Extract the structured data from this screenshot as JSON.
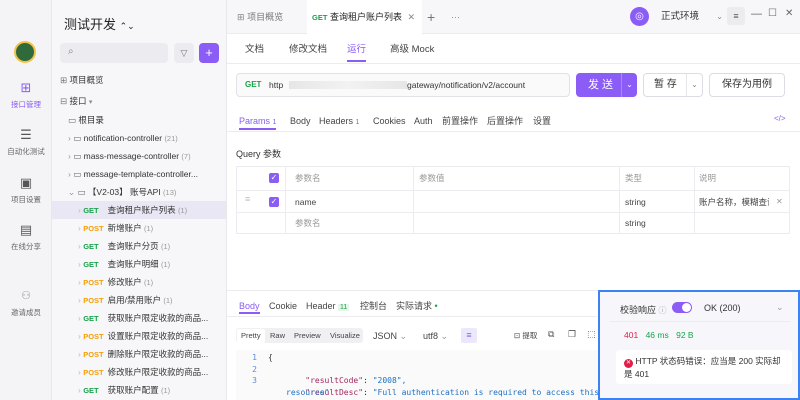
{
  "sidebar_rail": {
    "items": [
      {
        "label": "接口管理",
        "icon": "api-icon"
      },
      {
        "label": "自动化测试",
        "icon": "flask-icon"
      },
      {
        "label": "项目设置",
        "icon": "settings-icon"
      },
      {
        "label": "在线分享",
        "icon": "share-icon"
      },
      {
        "label": "邀请成员",
        "icon": "user-plus-icon"
      }
    ]
  },
  "project": {
    "title": "测试开发",
    "search_placeholder": "",
    "overview_label": "项目概览",
    "folder_label": "接口",
    "root_label": "根目录",
    "tree": [
      {
        "label": "notification-controller",
        "count": "(21)"
      },
      {
        "label": "mass-message-controller",
        "count": "(7)"
      },
      {
        "label": "message-template-controller...",
        "count": ""
      },
      {
        "label": "【V2-03】 账号API",
        "count": "(13)"
      }
    ],
    "endpoints": [
      {
        "method": "GET",
        "label": "查询租户账户列表",
        "count": "(1)"
      },
      {
        "method": "POST",
        "label": "新增账户",
        "count": "(1)"
      },
      {
        "method": "GET",
        "label": "查询账户分页",
        "count": "(1)"
      },
      {
        "method": "GET",
        "label": "查询账户明细",
        "count": "(1)"
      },
      {
        "method": "POST",
        "label": "修改账户",
        "count": "(1)"
      },
      {
        "method": "POST",
        "label": "启用/禁用账户",
        "count": "(1)"
      },
      {
        "method": "GET",
        "label": "获取账户限定收款的商品...",
        "count": ""
      },
      {
        "method": "POST",
        "label": "设置账户限定收款的商品...",
        "count": ""
      },
      {
        "method": "POST",
        "label": "删除账户限定收款的商品...",
        "count": ""
      },
      {
        "method": "POST",
        "label": "修改账户限定收款的商品...",
        "count": ""
      },
      {
        "method": "GET",
        "label": "获取账户配置",
        "count": "(1)"
      }
    ]
  },
  "top_tabs": {
    "overview": "项目概览",
    "active_method": "GET",
    "active_label": "查询租户账户列表",
    "add": "+",
    "more": "···",
    "env": "正式环境"
  },
  "sub_tabs": [
    "文档",
    "修改文档",
    "运行",
    "高级 Mock"
  ],
  "request": {
    "method": "GET",
    "url_prefix": "http",
    "url_suffix": "gateway/notification/v2/account",
    "send": "发 送",
    "save": "暂 存",
    "save_case": "保存为用例"
  },
  "param_tabs": [
    {
      "label": "Params",
      "badge": "1"
    },
    {
      "label": "Body",
      "badge": ""
    },
    {
      "label": "Headers",
      "badge": "1"
    },
    {
      "label": "Cookies",
      "badge": ""
    },
    {
      "label": "Auth",
      "badge": ""
    },
    {
      "label": "前置操作",
      "badge": ""
    },
    {
      "label": "后置操作",
      "badge": ""
    },
    {
      "label": "设置",
      "badge": ""
    }
  ],
  "query": {
    "title": "Query 参数",
    "headers": {
      "name": "参数名",
      "value": "参数值",
      "type": "类型",
      "desc": "说明"
    },
    "row": {
      "name": "name",
      "value": "",
      "type": "string",
      "desc": "账户名称，模糊查询"
    },
    "empty_row": {
      "name": "参数名",
      "type": "string"
    }
  },
  "response_tabs": [
    {
      "label": "Body",
      "badge": ""
    },
    {
      "label": "Cookie",
      "badge": ""
    },
    {
      "label": "Header",
      "badge": "11"
    },
    {
      "label": "控制台",
      "badge": ""
    },
    {
      "label": "实际请求",
      "badge": "•"
    }
  ],
  "response_tools": {
    "pretty": "Pretty",
    "raw": "Raw",
    "preview": "Preview",
    "visualize": "Visualize",
    "format": "JSON",
    "encoding": "utf8",
    "extract": "提取"
  },
  "code_lines": [
    {
      "n": "1",
      "text": "{"
    },
    {
      "n": "2",
      "key": "\"resultCode\"",
      "val": "\"2008\","
    },
    {
      "n": "3",
      "key": "\"resultDesc\"",
      "val": "\"Full authentication is required to access this"
    },
    {
      "n": "",
      "key": "",
      "val": "resource\""
    }
  ],
  "validation": {
    "label": "校验响应",
    "status": "OK (200)",
    "code": "401",
    "time": "46 ms",
    "size": "92 B",
    "error": "HTTP 状态码错误：应当是 200 实际却是 401"
  },
  "colors": {
    "accent": "#8b5cf6",
    "get": "#17a34a",
    "post": "#f59e0b",
    "error": "#e11d48"
  }
}
